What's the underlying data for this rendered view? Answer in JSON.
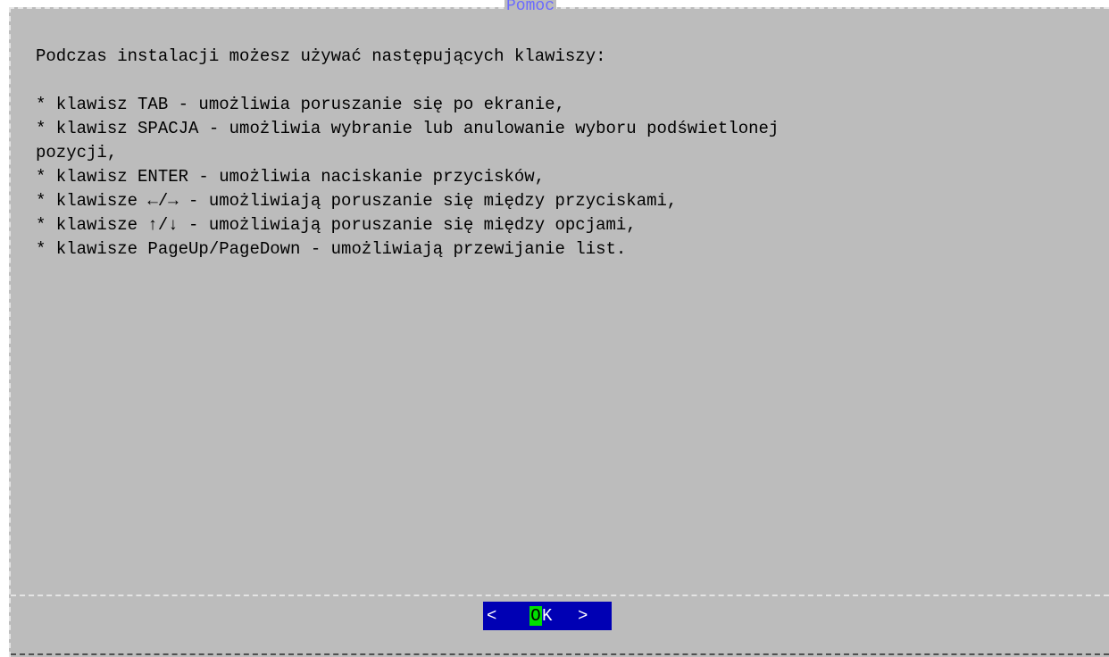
{
  "dialog": {
    "title": "Pomoc",
    "lines": [
      "Podczas instalacji możesz używać następujących klawiszy:",
      "",
      "* klawisz TAB - umożliwia poruszanie się po ekranie,",
      "* klawisz SPACJA - umożliwia wybranie lub anulowanie wyboru podświetlonej",
      "pozycji,",
      "* klawisz ENTER - umożliwia naciskanie przycisków,",
      "* klawisze ←/→ - umożliwiają poruszanie się między przyciskami,",
      "* klawisze ↑/↓ - umożliwiają poruszanie się między opcjami,",
      "* klawisze PageUp/PageDown - umożliwiają przewijanie list."
    ]
  },
  "buttons": {
    "ok": {
      "left_bracket": "<",
      "first_letter": "O",
      "rest": "K",
      "right_bracket": ">"
    }
  },
  "colors": {
    "background": "#bcbcbc",
    "title": "#6a6aff",
    "button": "#0000b4",
    "hotkey": "#00e000"
  }
}
